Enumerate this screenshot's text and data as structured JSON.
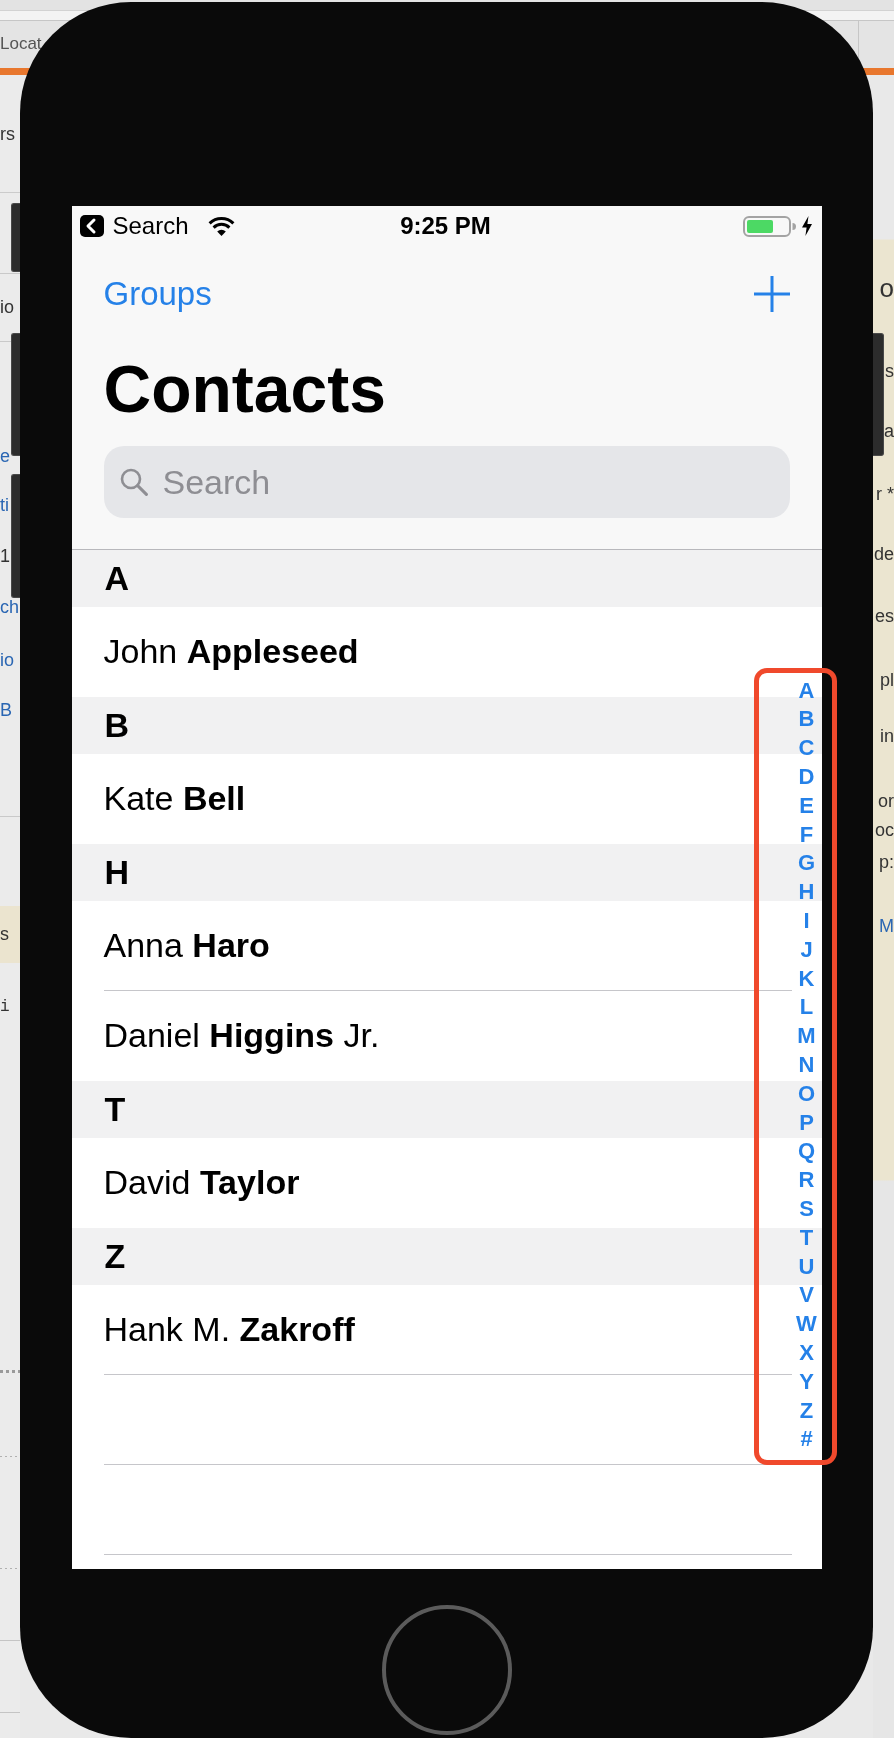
{
  "background_window": {
    "tab_label": "Locat",
    "left_fragments": [
      {
        "text": "rs",
        "kind": "text"
      },
      {
        "text": "io",
        "kind": "text"
      },
      {
        "text": "e",
        "kind": "link"
      },
      {
        "text": "ti",
        "kind": "link"
      },
      {
        "text": "1",
        "kind": "text"
      },
      {
        "text": "ch",
        "kind": "link"
      },
      {
        "text": "io",
        "kind": "link"
      },
      {
        "text": "B",
        "kind": "link"
      },
      {
        "text": "s",
        "kind": "highlight"
      },
      {
        "text": "i",
        "kind": "code"
      }
    ],
    "right_fragments": [
      {
        "text": "o",
        "kind": "heading"
      },
      {
        "text": "s",
        "kind": "text"
      },
      {
        "text": "a",
        "kind": "text"
      },
      {
        "text": "r *",
        "kind": "text"
      },
      {
        "text": "de",
        "kind": "text"
      },
      {
        "text": "es",
        "kind": "text"
      },
      {
        "text": "pl",
        "kind": "text"
      },
      {
        "text": "in",
        "kind": "text"
      },
      {
        "text": "or",
        "kind": "text"
      },
      {
        "text": "oc",
        "kind": "text"
      },
      {
        "text": "p:",
        "kind": "text"
      },
      {
        "text": "M",
        "kind": "link"
      }
    ]
  },
  "status_bar": {
    "back_label": "Search",
    "time": "9:25 PM",
    "charging": true
  },
  "nav_bar": {
    "left_button": "Groups",
    "title": "Contacts"
  },
  "search": {
    "placeholder": "Search"
  },
  "sections": [
    {
      "letter": "A",
      "contacts": [
        {
          "name": "John **Appleseed**"
        }
      ]
    },
    {
      "letter": "B",
      "contacts": [
        {
          "name": "Kate **Bell**"
        }
      ]
    },
    {
      "letter": "H",
      "contacts": [
        {
          "name": "Anna **Haro**"
        },
        {
          "name": "Daniel **Higgins** Jr."
        }
      ]
    },
    {
      "letter": "T",
      "contacts": [
        {
          "name": "David **Taylor**"
        }
      ]
    },
    {
      "letter": "Z",
      "contacts": [
        {
          "name": "Hank M. **Zakroff**"
        }
      ]
    }
  ],
  "section_index": [
    "A",
    "B",
    "C",
    "D",
    "E",
    "F",
    "G",
    "H",
    "I",
    "J",
    "K",
    "L",
    "M",
    "N",
    "O",
    "P",
    "Q",
    "R",
    "S",
    "T",
    "U",
    "V",
    "W",
    "X",
    "Y",
    "Z",
    "#"
  ]
}
